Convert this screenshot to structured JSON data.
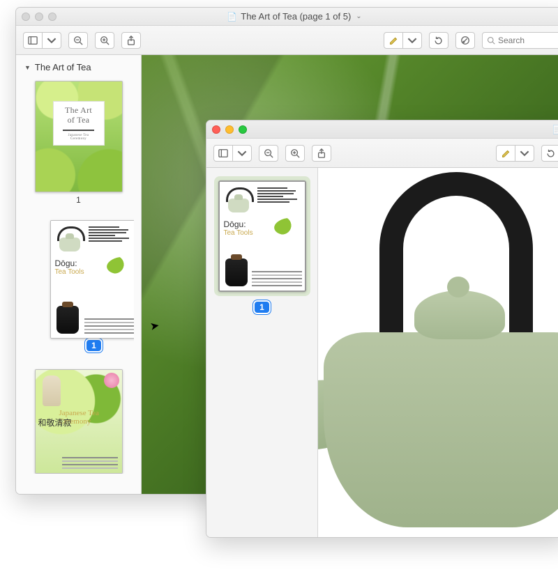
{
  "mainWindow": {
    "title": "The Art of Tea (page 1 of 5)",
    "toolbar": {
      "search_placeholder": "Search"
    },
    "sidebar": {
      "doc_title": "The Art of Tea",
      "pages": [
        {
          "index": "1",
          "cover_title_line1": "The Art",
          "cover_title_line2": "of Tea",
          "cover_subtitle": "Japanese Tea Ceremony"
        },
        {
          "badge": "1",
          "heading_jp": "Dōgu:",
          "heading_en": "Tea Tools"
        },
        {
          "title_a": "Japanese Tea",
          "title_b": "Ceremony",
          "kanji": "和敬清寂"
        }
      ]
    }
  },
  "childWindow": {
    "sidebar": {
      "badge": "1",
      "heading_jp": "Dōgu:",
      "heading_en": "Tea Tools"
    }
  }
}
